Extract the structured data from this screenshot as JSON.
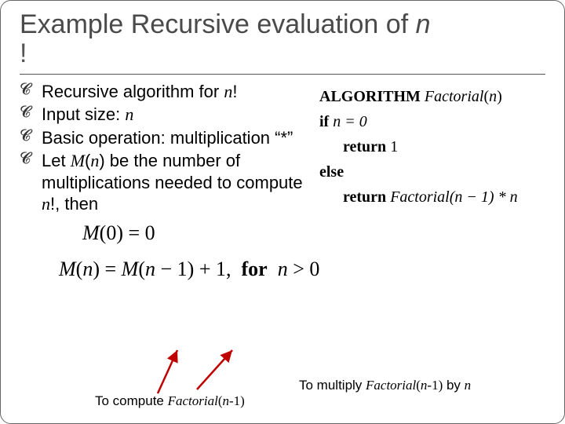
{
  "title": {
    "pre": "Example Recursive evaluation of ",
    "var": "n",
    "bang": "!"
  },
  "bullets": [
    {
      "pre": "Recursive algorithm for ",
      "var": "n",
      "suf": "!"
    },
    {
      "pre": "Input size: ",
      "var": "n",
      "suf": ""
    },
    {
      "pre": "Basic operation: multiplication “*”",
      "var": "",
      "suf": ""
    },
    {
      "pre": "Let ",
      "var": "M",
      "mid": "(",
      "var2": "n",
      "suf": ") be the number of multiplications needed to compute ",
      "var3": "n",
      "tail": "!, then"
    }
  ],
  "algorithm": {
    "head_kw": "ALGORITHM",
    "head_name": "Factorial",
    "head_arg": "n",
    "if_kw": "if",
    "cond": "n = 0",
    "return1_kw": "return",
    "return1_val": "1",
    "else_kw": "else",
    "return2_kw": "return",
    "return2_val_a": "Factorial",
    "return2_val_b": "(n − 1) * n"
  },
  "equations": {
    "base": "M(0) = 0",
    "rec": "M(n) = M(n − 1) + 1,  for  n > 0",
    "for_kw": "for"
  },
  "captions": {
    "left_pre": "To compute ",
    "left_it": "Factorial",
    "left_suf": "(n-1)",
    "right_pre": "To multiply ",
    "right_it": "Factorial",
    "right_mid": "(n-1) by ",
    "right_var": "n"
  }
}
